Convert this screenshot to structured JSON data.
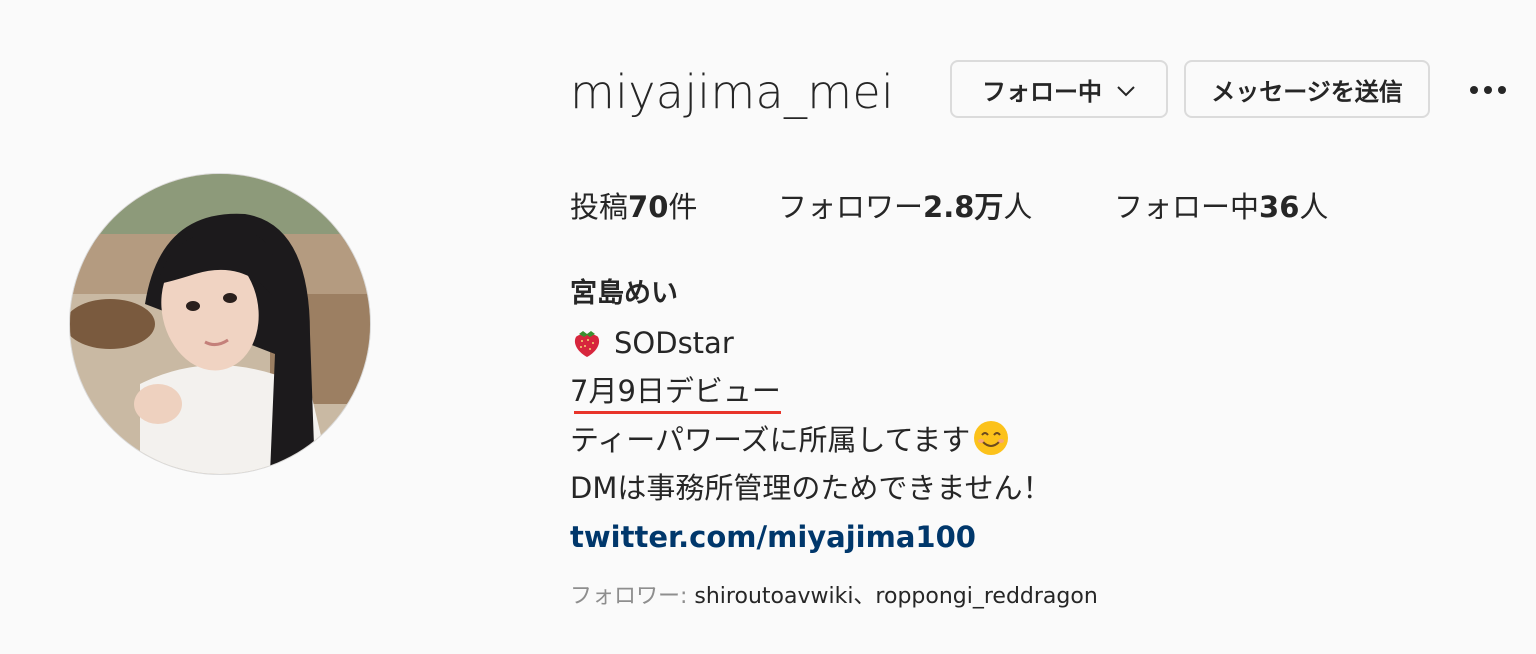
{
  "profile": {
    "username": "miyajima_mei",
    "follow_button_label": "フォロー中",
    "message_button_label": "メッセージを送信"
  },
  "stats": {
    "posts": {
      "label": "投稿",
      "value": "70",
      "suffix": "件"
    },
    "followers": {
      "label": "フォロワー",
      "value": "2.8万",
      "suffix": "人"
    },
    "following": {
      "label": "フォロー中",
      "value": "36",
      "suffix": "人"
    }
  },
  "bio": {
    "full_name": "宮島めい",
    "line1": "SODstar",
    "line2": "7月9日デビュー",
    "line3": "ティーパワーズに所属してます",
    "line4": "DMは事務所管理のためできません！",
    "link": "twitter.com/miyajima100"
  },
  "followed_by": {
    "label": "フォロワー: ",
    "names": "shiroutoavwiki、roppongi_reddragon"
  },
  "icons": [
    "chevron-down-icon",
    "more-options-icon",
    "strawberry-emoji",
    "smile-emoji"
  ],
  "colors": {
    "background": "#fafafa",
    "text": "#262626",
    "link": "#00376b",
    "muted": "#8e8e8e",
    "border": "#dbdbdb",
    "annotation_underline": "#e8342a"
  }
}
